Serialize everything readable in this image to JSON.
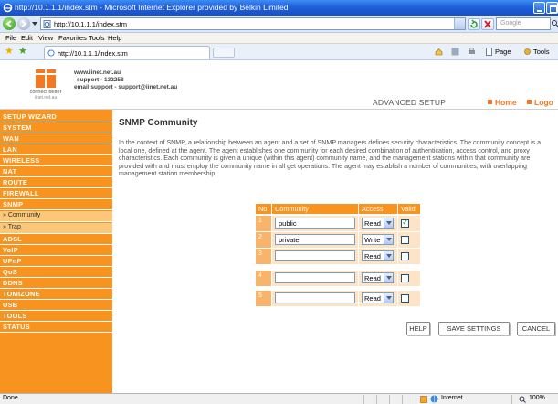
{
  "window": {
    "title": "http://10.1.1.1/index.stm - Microsoft Internet Explorer provided by Belkin Limited"
  },
  "address": {
    "url": "http://10.1.1.1/index.stm",
    "search_placeholder": "Google"
  },
  "menu": [
    "File",
    "Edit",
    "View",
    "Favorites",
    "Tools",
    "Help"
  ],
  "tab": {
    "label": "http://10.1.1.1/index.stm"
  },
  "commands": {
    "page": "Page",
    "tools": "Tools"
  },
  "header": {
    "brand_line1": "connect better",
    "brand_line2": "iinet.net.au",
    "contact": [
      "www.iinet.net.au",
      "support - 132258",
      "email support - support@iinet.net.au"
    ],
    "section": "ADVANCED SETUP",
    "home": "Home",
    "logout": "Logo"
  },
  "sidebar": {
    "items": [
      {
        "label": "SETUP WIZARD",
        "sub": false
      },
      {
        "label": "SYSTEM",
        "sub": false
      },
      {
        "label": "WAN",
        "sub": false
      },
      {
        "label": "LAN",
        "sub": false
      },
      {
        "label": "WIRELESS",
        "sub": false
      },
      {
        "label": "NAT",
        "sub": false
      },
      {
        "label": "ROUTE",
        "sub": false
      },
      {
        "label": "FIREWALL",
        "sub": false
      },
      {
        "label": "SNMP",
        "sub": false
      },
      {
        "label": "» Community",
        "sub": true
      },
      {
        "label": "» Trap",
        "sub": true
      },
      {
        "label": "ADSL",
        "sub": false
      },
      {
        "label": "VoIP",
        "sub": false
      },
      {
        "label": "UPnP",
        "sub": false
      },
      {
        "label": "QoS",
        "sub": false
      },
      {
        "label": "DDNS",
        "sub": false
      },
      {
        "label": "TOMIZONE",
        "sub": false
      },
      {
        "label": "USB",
        "sub": false
      },
      {
        "label": "TOOLS",
        "sub": false
      },
      {
        "label": "STATUS",
        "sub": false
      }
    ]
  },
  "main": {
    "title": "SNMP Community",
    "description": "In the context of SNMP, a relationship between an agent and a set of SNMP managers defines security characteristics. The community concept is a local one, defined at the agent. The agent establishes one community for each desired combination of authentication, access control, and proxy characteristics. Each community is given a unique (within this agent) community name, and the management stations within that community are provided with and must employ the community name in all get operations. The agent may establish a number of communities, with overlapping management station membership.",
    "table": {
      "headers": [
        "No.",
        "Community",
        "Access",
        "Valid"
      ],
      "rows": [
        {
          "no": "1",
          "community": "public",
          "access": "Read",
          "valid": true
        },
        {
          "no": "2",
          "community": "private",
          "access": "Write",
          "valid": false
        },
        {
          "no": "3",
          "community": "",
          "access": "Read",
          "valid": false
        },
        {
          "no": "4",
          "community": "",
          "access": "Read",
          "valid": false
        },
        {
          "no": "5",
          "community": "",
          "access": "Read",
          "valid": false
        }
      ]
    },
    "buttons": {
      "help": "HELP",
      "save": "SAVE SETTINGS",
      "cancel": "CANCEL"
    }
  },
  "status": {
    "left": "Done",
    "zone": "Internet",
    "zoom": "100%"
  },
  "colors": {
    "accent": "#f7931e",
    "titlebar": "#1f5fd8"
  }
}
